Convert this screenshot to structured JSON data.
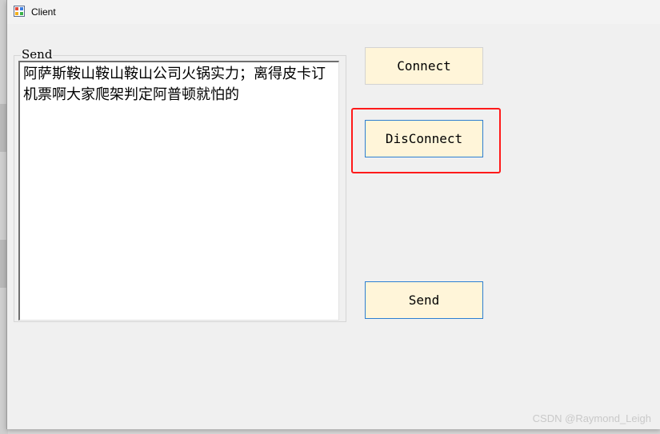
{
  "window": {
    "title": "Client"
  },
  "send_group": {
    "label": "Send",
    "textarea_value": "阿萨斯鞍山鞍山鞍山公司火锅实力；离得皮卡订机票啊大家爬架判定阿普顿就怕的"
  },
  "buttons": {
    "connect": "Connect",
    "disconnect": "DisConnect",
    "send": "Send"
  },
  "watermark": "CSDN @Raymond_Leigh",
  "colors": {
    "button_bg": "#fff5d9",
    "focus_border": "#2d7fd1",
    "highlight": "#ff1a1a"
  }
}
